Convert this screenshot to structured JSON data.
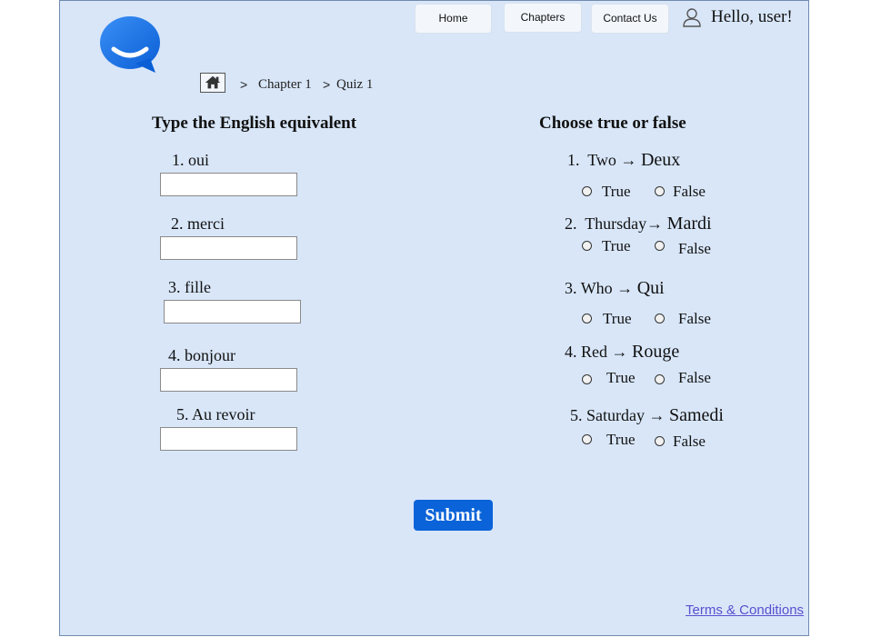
{
  "nav": {
    "home_label": "Home",
    "chapters_label": "Chapters",
    "contact_label": "Contact Us",
    "greeting": "Hello, user!"
  },
  "breadcrumb": {
    "separator": ">",
    "chapter": "Chapter 1",
    "quiz": "Quiz 1"
  },
  "left_section": {
    "title": "Type the English equivalent",
    "questions": [
      {
        "number": "1.",
        "word": "oui",
        "value": ""
      },
      {
        "number": "2.",
        "word": "merci",
        "value": ""
      },
      {
        "number": "3.",
        "word": "fille",
        "value": ""
      },
      {
        "number": "4.",
        "word": "bonjour",
        "value": ""
      },
      {
        "number": "5.",
        "word": "Au revoir",
        "value": ""
      }
    ]
  },
  "right_section": {
    "title": "Choose true or false",
    "arrow": "→",
    "true_label": "True",
    "false_label": "False",
    "questions": [
      {
        "number": "1.",
        "english": "Two",
        "french": "Deux"
      },
      {
        "number": "2.",
        "english": "Thursday",
        "french": "Mardi"
      },
      {
        "number": "3.",
        "english": "Who",
        "french": "Qui"
      },
      {
        "number": "4.",
        "english": "Red",
        "french": "Rouge"
      },
      {
        "number": "5.",
        "english": "Saturday",
        "french": "Samedi"
      }
    ]
  },
  "submit_label": "Submit",
  "footer": {
    "terms_label": "Terms & Conditions"
  },
  "colors": {
    "background": "#d8e6f8",
    "accent": "#0a63d8",
    "link": "#5a4fcf"
  }
}
